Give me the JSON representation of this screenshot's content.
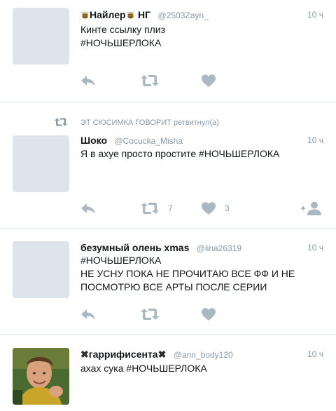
{
  "tweets": [
    {
      "name": "Найлер",
      "name_suffix": "НГ",
      "handle": "@2503Zayn_",
      "time": "10 ч",
      "text": "Кинте ссылку плиз\n#НОЧЬШЕРЛОКА",
      "retweets": "",
      "likes": ""
    },
    {
      "retweet_by": "ЭТ СЮСИМКА ГОВОРИТ ретвитнул(а)",
      "name": "Шоко",
      "handle": "@Cocucka_Misha",
      "time": "10 ч",
      "text": "Я в ахуе просто простите #НОЧЬШЕРЛОКА",
      "retweets": "7",
      "likes": "3"
    },
    {
      "name": "безумный олень xmas",
      "handle": "@lina26319",
      "time": "10 ч",
      "text": "#НОЧЬШЕРЛОКА\nНЕ УСНУ ПОКА НЕ ПРОЧИТАЮ ВСЕ ФФ И НЕ ПОСМОТРЮ ВСЕ АРТЫ ПОСЛЕ СЕРИИ",
      "retweets": "",
      "likes": ""
    },
    {
      "name": "гаррифисента",
      "handle": "@ann_body120",
      "time": "10 ч",
      "text": "ахах сука #НОЧЬШЕРЛОКА"
    }
  ],
  "icons": {
    "reply": "reply-icon",
    "retweet": "retweet-icon",
    "like": "heart-icon",
    "follow": "follow-icon"
  },
  "colors": {
    "icon": "#aab8c2",
    "meta": "#8899a6",
    "text": "#14171a",
    "avatar_placeholder": "#dde4ec"
  }
}
